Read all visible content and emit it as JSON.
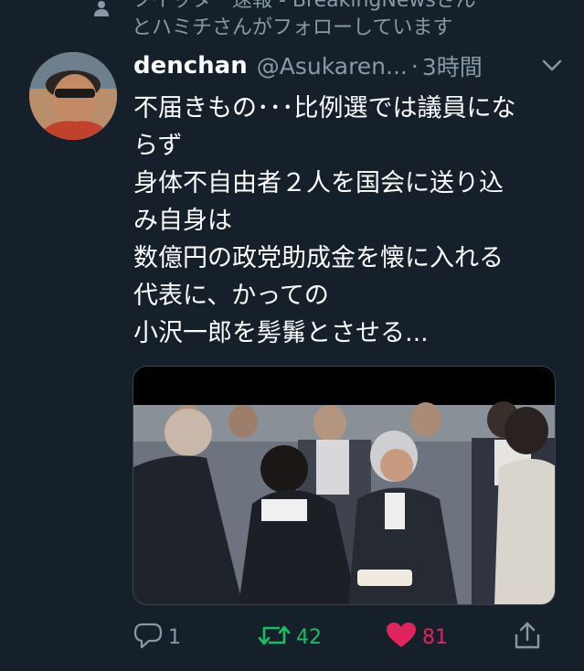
{
  "social_context": {
    "line1": "ツイッター速報 - BreakingNewsさん",
    "line2": "とハミチさんがフォローしています"
  },
  "tweet": {
    "display_name": "denchan",
    "handle": "@Asukaren...",
    "separator": "·",
    "time": "3時間",
    "text_lines": [
      "不届きもの･･･比例選では議員にな",
      "らず",
      "身体不自由者２人を国会に送り込",
      "み自身は",
      "数億円の政党助成金を懐に入れる",
      "代表に、かっての",
      "小沢一郎を髣髴とさせる..."
    ],
    "media": {
      "kind": "photo"
    }
  },
  "actions": {
    "reply_count": "1",
    "retweet_count": "42",
    "like_count": "81"
  },
  "colors": {
    "background": "#15202b",
    "secondary_text": "#8899a6",
    "retweet_active": "#17bf63",
    "like_active": "#e0245e"
  },
  "icons": [
    "person-icon",
    "chevron-down-icon",
    "reply-icon",
    "retweet-icon",
    "heart-icon",
    "share-icon"
  ]
}
